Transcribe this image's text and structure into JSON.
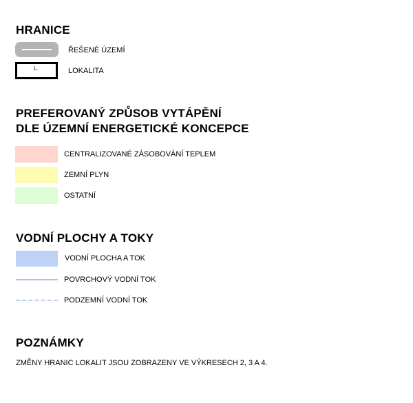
{
  "sections": {
    "boundaries": {
      "heading": "HRANICE",
      "items": [
        {
          "label": "ŘEŠENÉ ÚZEMÍ",
          "swatch": "gray-rounded-bar-with-white-line",
          "color": "#b4b4b4"
        },
        {
          "label": "LOKALITA",
          "swatch": "black-outlined-rectangle",
          "swatch_text": "L."
        }
      ]
    },
    "heating": {
      "heading_line1": "PREFEROVANÝ ZPŮSOB VYTÁPĚNÍ",
      "heading_line2": "DLE ÚZEMNÍ ENERGETICKÉ KONCEPCE",
      "items": [
        {
          "label": "CENTRALIZOVANÉ ZÁSOBOVÁNÍ TEPLEM",
          "color": "#ffd5cf"
        },
        {
          "label": "ZEMNÍ PLYN",
          "color": "#fdfcb0"
        },
        {
          "label": "OSTATNÍ",
          "color": "#ddfdd6"
        }
      ]
    },
    "water": {
      "heading": "VODNÍ PLOCHY A TOKY",
      "items": [
        {
          "label": "VODNÍ PLOCHA A TOK",
          "swatch": "fill",
          "color": "#bed2f7"
        },
        {
          "label": "POVRCHOVÝ VODNÍ TOK",
          "swatch": "solid-line",
          "color": "#a9c5ec"
        },
        {
          "label": "PODZEMNÍ VODNÍ TOK",
          "swatch": "dashed-line",
          "color": "#bfd0f0"
        }
      ]
    },
    "notes": {
      "heading": "POZNÁMKY",
      "text": "ZMĚNY HRANIC LOKALIT JSOU ZOBRAZENY VE VÝKRESECH 2, 3 A 4."
    }
  }
}
